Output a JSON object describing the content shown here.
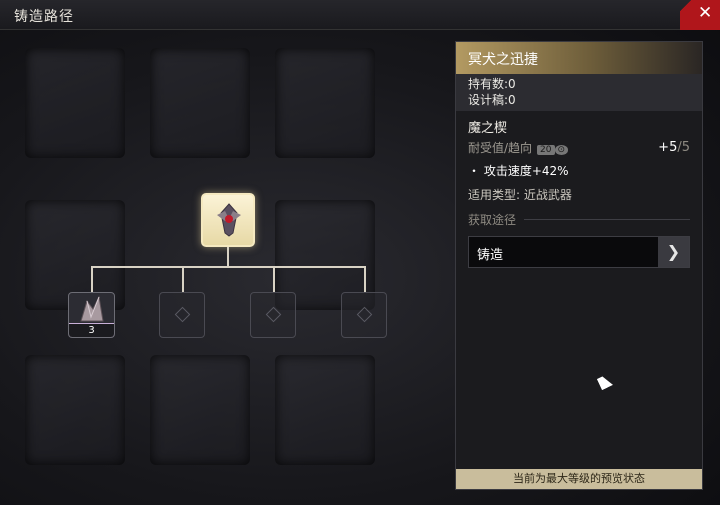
{
  "window": {
    "title": "铸造路径",
    "close_icon": "close-icon"
  },
  "tree": {
    "main_item_icon": "weapon-emblem-icon",
    "material_item_icon": "material-item-icon",
    "material_count": "3",
    "empty_slots": 3
  },
  "panel": {
    "title": "冥犬之迅捷",
    "owned": "持有数:0",
    "blueprints": "设计稿:0",
    "item_name": "魔之楔",
    "durability_label": "耐受值/趋向",
    "durability_badge": "20",
    "level_value": "+5",
    "level_max": "/5",
    "stat": "・ 攻击速度+42%",
    "applicable_type": "适用类型: 近战武器",
    "source_title": "获取途径",
    "source_button": "铸造",
    "footer": "当前为最大等级的预览状态"
  },
  "colors": {
    "accent": "#b0161b",
    "panel_header": "#b39a62",
    "footer": "#c9bd9c"
  }
}
